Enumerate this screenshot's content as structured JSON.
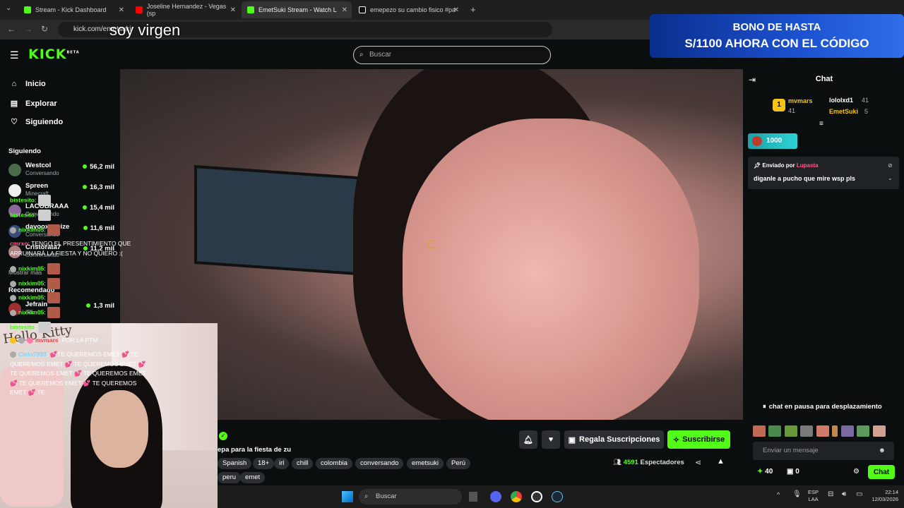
{
  "browser": {
    "tabs": [
      {
        "title": "Stream - Kick Dashboard"
      },
      {
        "title": "Joseline Hernandez - Vegas (sp"
      },
      {
        "title": "EmetSuki Stream - Watch L"
      },
      {
        "title": "emepezo su cambio fisico #pa"
      }
    ],
    "url": "kick.com/emetsuki"
  },
  "overlay_text": "soy virgen",
  "banner": {
    "line1": "BONO DE HASTA",
    "line2": "S/1100 AHORA CON EL CÓDIGO"
  },
  "header": {
    "logo": "KICK",
    "logo_badge": "BETA",
    "search_placeholder": "Buscar"
  },
  "sidebar": {
    "nav": [
      {
        "label": "Inicio",
        "icon": "home-icon"
      },
      {
        "label": "Explorar",
        "icon": "compass-icon"
      },
      {
        "label": "Siguiendo",
        "icon": "heart-icon"
      }
    ],
    "following_title": "Siguiendo",
    "following": [
      {
        "name": "Westcol",
        "category": "Conversando",
        "viewers": "56,2 mil"
      },
      {
        "name": "Spreen",
        "category": "Minecraft",
        "viewers": "16,3 mil"
      },
      {
        "name": "LACOBRAAA",
        "category": "Conversando",
        "viewers": "15,4 mil"
      },
      {
        "name": "davooxeneize",
        "category": "Conversando",
        "viewers": "11,6 mil"
      },
      {
        "name": "Cristorata7",
        "category": "Conversando",
        "viewers": "11,2 mil"
      }
    ],
    "show_more": "Mostrar más",
    "recommended_title": "Recomendado",
    "recommended": [
      {
        "name": "Jefrain",
        "category": "IRL",
        "viewers": "1,3 mil"
      }
    ]
  },
  "webcam": {
    "text": "Hello Kitty"
  },
  "stream": {
    "title": "epa para la fiesta de zu",
    "tags": [
      "Spanish",
      "18+",
      "irl",
      "chill",
      "colombia",
      "conversando",
      "emetsuki",
      "Perú",
      "peru",
      "emet"
    ],
    "gift_label": "Regala Suscripciones",
    "subscribe_label": "Suscribirse",
    "viewers": "4591",
    "viewers_label": "Espectadores"
  },
  "chat": {
    "title": "Chat",
    "top_gifters": [
      {
        "rank": "1",
        "name": "mvmars",
        "count": "41"
      },
      {
        "name": "lololxd1",
        "count": "41"
      },
      {
        "name": "EmetSuki",
        "count": "5"
      }
    ],
    "goal": "1000",
    "pinned": {
      "prefix": "Enviado por",
      "user": "Lupasta",
      "message": "díganle a pucho que mire wsp pls"
    },
    "messages": [
      {
        "user": "bistesito",
        "color": "#53fc18",
        "text": ""
      },
      {
        "user": "bistesito",
        "color": "#53fc18",
        "text": ""
      },
      {
        "user": "nixkim05",
        "color": "#53fc18",
        "text": ""
      },
      {
        "user": "cmrxo",
        "color": "#ff5c8a",
        "text": "TENGO EL PRESENTIMIENTO QUE ARRUINARÁ LA FIESTA Y NO QUIERO :("
      },
      {
        "user": "nixkim05",
        "color": "#53fc18",
        "text": ""
      },
      {
        "user": "nixkim05",
        "color": "#53fc18",
        "text": ""
      },
      {
        "user": "nixkim05",
        "color": "#53fc18",
        "text": ""
      },
      {
        "user": "nixkim05",
        "color": "#53fc18",
        "text": ""
      },
      {
        "user": "bistesito",
        "color": "#53fc18",
        "text": ""
      },
      {
        "user": "mvmars",
        "color": "#ff3b3b",
        "text": "POR LA PTM"
      },
      {
        "user": "Cielo7893",
        "color": "#7fd3ff",
        "text": "💕TE QUEREMOS EMET 💕 TE QUEREMOS EMET 💕 TE QUEREMOS EMET 💕 TE QUEREMOS EMET 💕 TE QUEREMOS EMET 💕 TE QUEREMOS EMET 💕 TE QUEREMOS EMET 💕 TE"
      }
    ],
    "paused": "chat en pausa para desplazamiento",
    "input_placeholder": "Enviar un mensaje",
    "points": "40",
    "gifts": "0",
    "send_label": "Chat"
  },
  "taskbar": {
    "search": "Buscar",
    "lang": "ESP",
    "lang2": "LAA",
    "time": "22:14",
    "date": "12/03/2026"
  }
}
